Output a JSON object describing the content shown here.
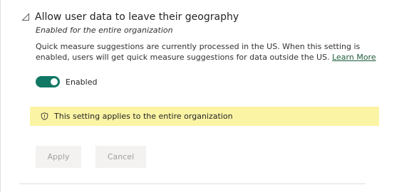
{
  "setting": {
    "title": "Allow user data to leave their geography",
    "subtitle": "Enabled for the entire organization",
    "description": "Quick measure suggestions are currently processed in the US. When this setting is enabled, users will get quick measure suggestions for data outside the US.",
    "learn_more": "Learn More",
    "collapse_icon": "triangle-collapse-icon"
  },
  "toggle": {
    "label": "Enabled",
    "state": "on",
    "color": "#117865"
  },
  "banner": {
    "icon": "shield-info-icon",
    "text": "This setting applies to the entire organization",
    "color": "#fbf4a5"
  },
  "actions": {
    "apply_label": "Apply",
    "cancel_label": "Cancel"
  }
}
